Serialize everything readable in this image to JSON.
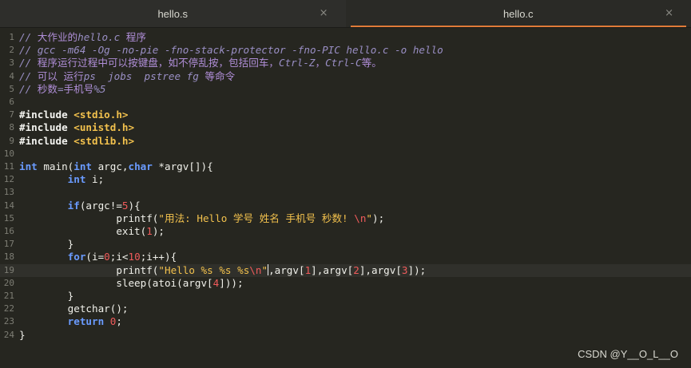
{
  "tabs": [
    {
      "name": "hello.s",
      "close": "×"
    },
    {
      "name": "hello.c",
      "close": "×"
    }
  ],
  "lines": [
    "// 大作业的hello.c 程序",
    "// gcc -m64 -Og -no-pie -fno-stack-protector -fno-PIC hello.c -o hello",
    "// 程序运行过程中可以按键盘，如不停乱按，包括回车，Ctrl-Z，Ctrl-C等。",
    "// 可以 运行ps  jobs  pstree fg 等命令",
    "// 秒数=手机号%5",
    "",
    "#include <stdio.h>",
    "#include <unistd.h>",
    "#include <stdlib.h>",
    "",
    "int main(int argc,char *argv[]){",
    "        int i;",
    "",
    "        if(argc!=5){",
    "                printf(\"用法: Hello 学号 姓名 手机号 秒数! \\n\");",
    "                exit(1);",
    "        }",
    "        for(i=0;i<10;i++){",
    "                printf(\"Hello %s %s %s\\n\",argv[1],argv[2],argv[3]);",
    "                sleep(atoi(argv[4]));",
    "        }",
    "        getchar();",
    "        return 0;",
    "}"
  ],
  "line_numbers": [
    "1",
    "2",
    "3",
    "4",
    "5",
    "6",
    "7",
    "8",
    "9",
    "10",
    "11",
    "12",
    "13",
    "14",
    "15",
    "16",
    "17",
    "18",
    "19",
    "20",
    "21",
    "22",
    "23",
    "24"
  ],
  "current_line": 19,
  "watermark": "CSDN @Y__O_L__O",
  "colors": {
    "background": "#262620",
    "comment": "#9a8fc5",
    "keyword": "#6a9bff",
    "string": "#f2c14d",
    "escape_number": "#f05b5b",
    "active_tab_underline": "#e07b38"
  }
}
